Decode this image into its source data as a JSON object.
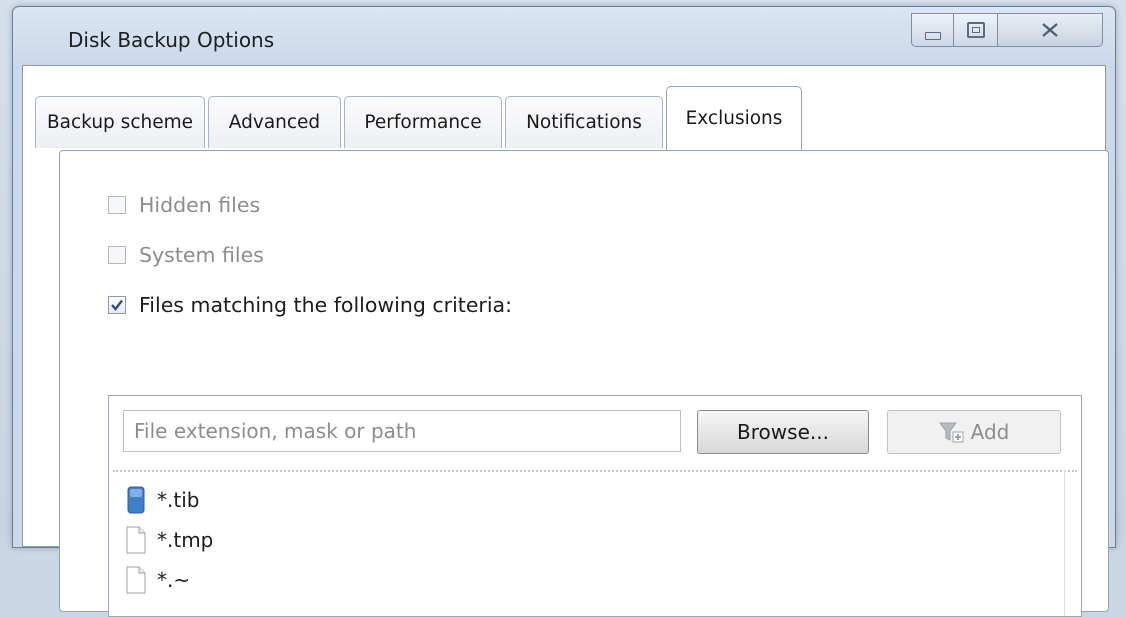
{
  "window": {
    "title": "Disk Backup Options"
  },
  "tabs": [
    {
      "label": "Backup scheme",
      "active": false
    },
    {
      "label": "Advanced",
      "active": false
    },
    {
      "label": "Performance",
      "active": false
    },
    {
      "label": "Notifications",
      "active": false
    },
    {
      "label": "Exclusions",
      "active": true
    }
  ],
  "exclusions": {
    "hidden_files": {
      "label": "Hidden files",
      "checked": false,
      "enabled": false
    },
    "system_files": {
      "label": "System files",
      "checked": false,
      "enabled": false
    },
    "matching": {
      "label": "Files matching the following criteria:",
      "checked": true,
      "enabled": true
    },
    "input": {
      "placeholder": "File extension, mask or path",
      "value": ""
    },
    "browse_label": "Browse...",
    "add_label": "Add",
    "items": [
      {
        "label": "*.tib",
        "icon": "tib-file-icon"
      },
      {
        "label": "*.tmp",
        "icon": "file-icon"
      },
      {
        "label": "*.~",
        "icon": "file-icon"
      }
    ]
  },
  "colors": {
    "accent_blue": "#3b78c4",
    "disabled_text": "#8d8d8d"
  }
}
